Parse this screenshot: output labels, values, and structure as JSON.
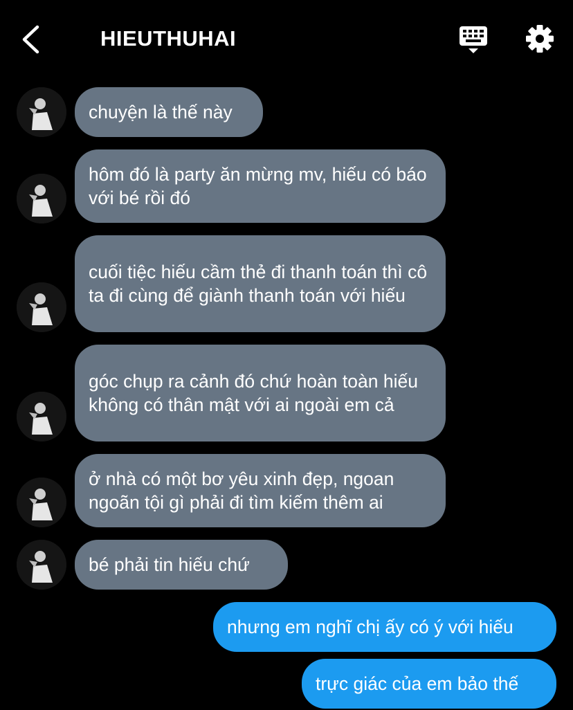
{
  "header": {
    "title": "HIEUTHUHAI",
    "back_icon": "chevron-left-icon",
    "keyboard_icon": "keyboard-icon",
    "settings_icon": "gear-icon"
  },
  "colors": {
    "background": "#000000",
    "incoming_bubble": "#677584",
    "outgoing_bubble": "#1c9bf0",
    "text": "#ffffff"
  },
  "messages": [
    {
      "direction": "incoming",
      "text": "chuyện là thế này"
    },
    {
      "direction": "incoming",
      "text": "hôm đó là party ăn mừng mv, hiếu có báo với bé rồi đó"
    },
    {
      "direction": "incoming",
      "text": "cuối tiệc hiếu cầm thẻ đi thanh toán thì cô ta đi cùng để giành thanh toán với hiếu"
    },
    {
      "direction": "incoming",
      "text": "góc chụp ra cảnh đó chứ hoàn toàn hiếu không có thân mật với ai ngoài em cả"
    },
    {
      "direction": "incoming",
      "text": "ở nhà có một bơ yêu xinh đẹp, ngoan ngoãn tội gì phải đi tìm kiếm thêm ai"
    },
    {
      "direction": "incoming",
      "text": "bé phải tin hiếu chứ"
    },
    {
      "direction": "outgoing",
      "text": "nhưng em nghĩ chị ấy có ý với hiếu"
    },
    {
      "direction": "outgoing",
      "text": "trực giác của em bảo thế"
    }
  ]
}
